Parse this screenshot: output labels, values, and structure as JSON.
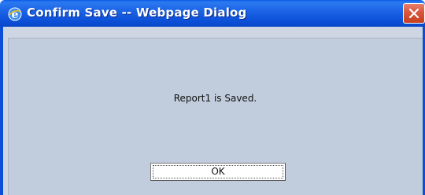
{
  "window": {
    "title": "Confirm Save -- Webpage Dialog"
  },
  "dialog": {
    "message": "Report1 is Saved.",
    "ok_label": "OK"
  },
  "icons": {
    "app": "internet-explorer-icon",
    "close": "close-icon"
  },
  "colors": {
    "titlebar": "#0b4fd7",
    "close_button": "#d8563c",
    "dialog_background": "#c1ccdc"
  }
}
